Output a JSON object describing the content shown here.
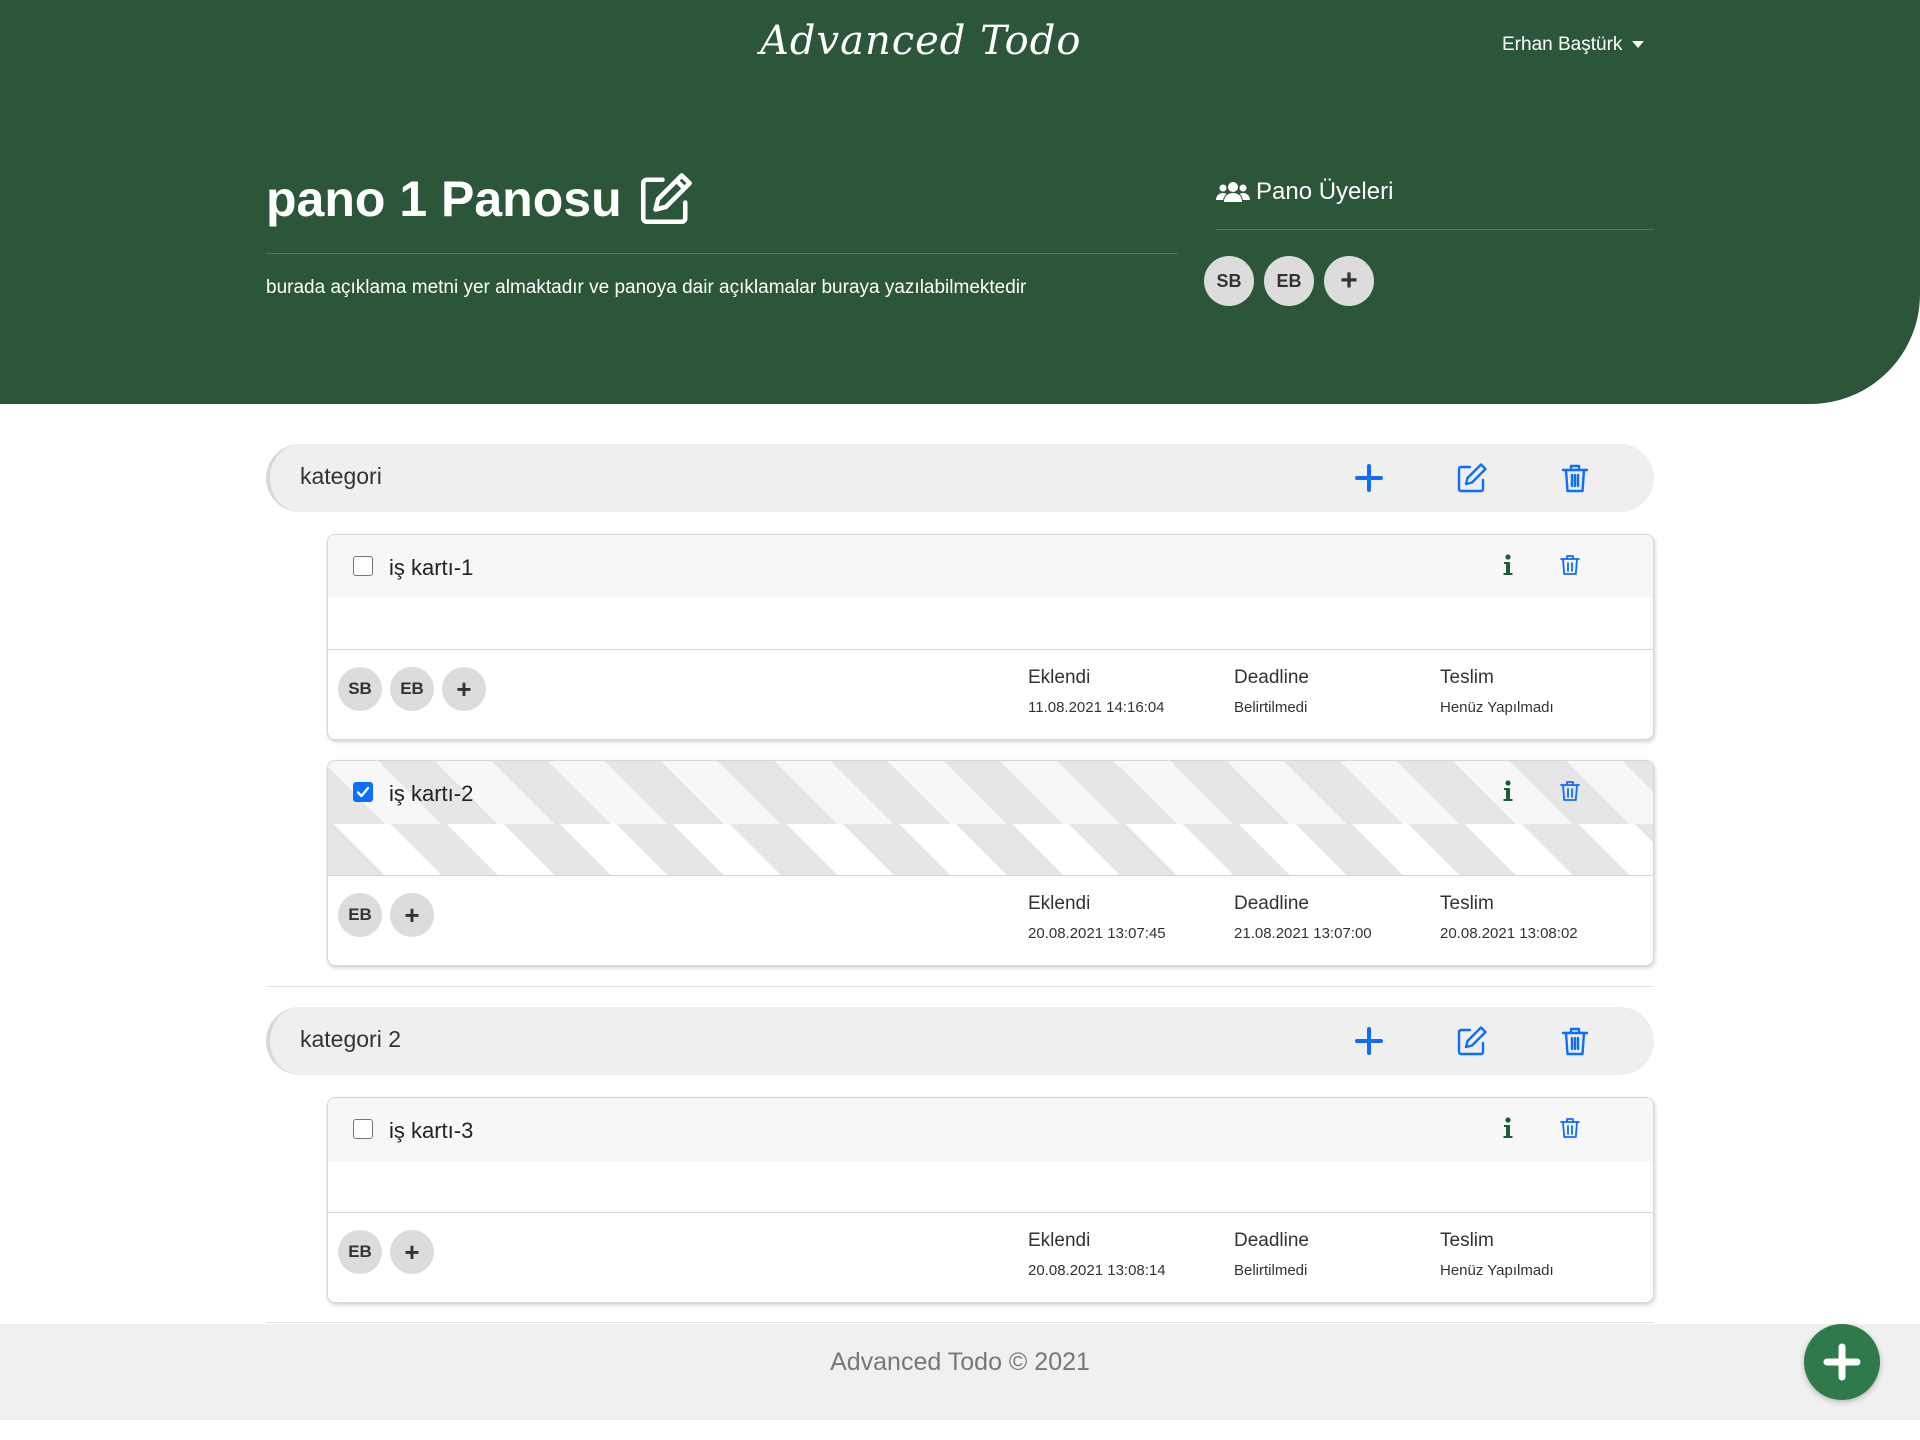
{
  "header": {
    "brand": "Advanced Todo",
    "user_name": "Erhan Baştürk"
  },
  "board": {
    "title": "pano 1 Panosu",
    "description": "burada açıklama metni yer almaktadır ve panoya dair açıklamalar buraya yazılabilmektedir",
    "members_title": "Pano Üyeleri",
    "members": [
      "SB",
      "EB"
    ],
    "add_symbol": "+"
  },
  "categories": [
    {
      "name": "kategori",
      "cards": [
        {
          "title": "iş kartı-1",
          "done": false,
          "members": [
            "SB",
            "EB"
          ],
          "added_label": "Eklendi",
          "added": "11.08.2021 14:16:04",
          "deadline_label": "Deadline",
          "deadline": "Belirtilmedi",
          "delivery_label": "Teslim",
          "delivery": "Henüz Yapılmadı"
        },
        {
          "title": "iş kartı-2",
          "done": true,
          "members": [
            "EB"
          ],
          "added_label": "Eklendi",
          "added": "20.08.2021 13:07:45",
          "deadline_label": "Deadline",
          "deadline": "21.08.2021 13:07:00",
          "delivery_label": "Teslim",
          "delivery": "20.08.2021 13:08:02"
        }
      ]
    },
    {
      "name": "kategori 2",
      "cards": [
        {
          "title": "iş kartı-3",
          "done": false,
          "members": [
            "EB"
          ],
          "added_label": "Eklendi",
          "added": "20.08.2021 13:08:14",
          "deadline_label": "Deadline",
          "deadline": "Belirtilmedi",
          "delivery_label": "Teslim",
          "delivery": "Henüz Yapılmadı"
        }
      ]
    }
  ],
  "footer": {
    "text": "Advanced Todo © 2021"
  },
  "colors": {
    "primary_green": "#2b5639",
    "fab_green": "#2f7a4a",
    "action_blue": "#0d6efd",
    "info_green": "#1e5e32"
  },
  "icons": {
    "edit": "pencil-square-icon",
    "add": "plus-icon",
    "delete": "trash-icon",
    "info": "info-icon",
    "members": "users-icon"
  }
}
